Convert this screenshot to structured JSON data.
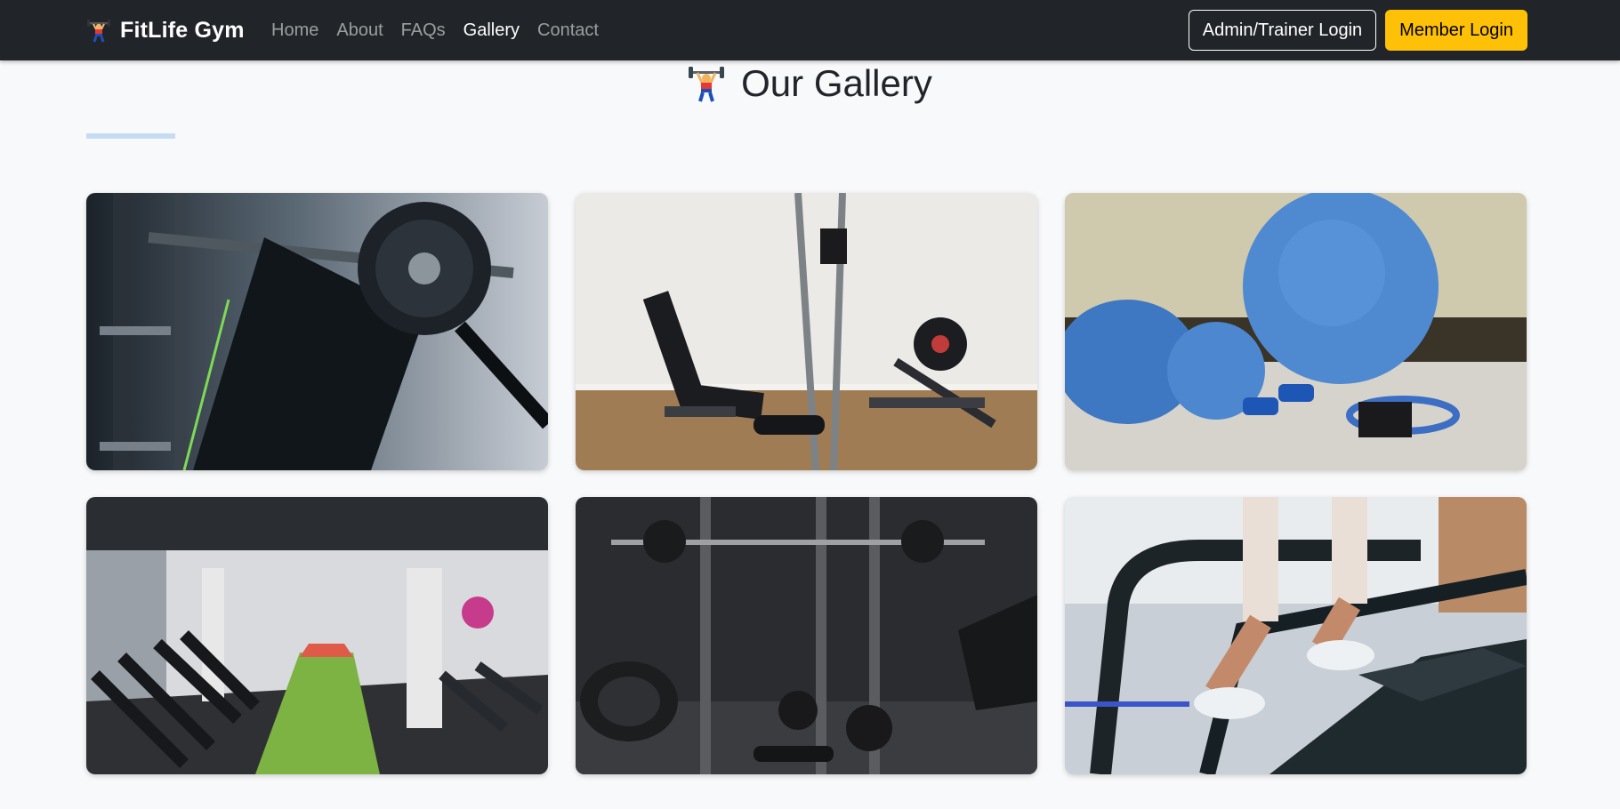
{
  "navbar": {
    "brand_icon": "weightlifter-icon",
    "brand": "FitLife Gym",
    "links": [
      {
        "label": "Home",
        "active": false
      },
      {
        "label": "About",
        "active": false
      },
      {
        "label": "FAQs",
        "active": false
      },
      {
        "label": "Gallery",
        "active": true
      },
      {
        "label": "Contact",
        "active": false
      }
    ],
    "admin_login": "Admin/Trainer Login",
    "member_login": "Member Login"
  },
  "gallery": {
    "title_icon": "weightlifter-icon",
    "title": "Our Gallery",
    "items": [
      "barbell-bench-photo",
      "home-gym-station-photo",
      "exercise-balls-photo",
      "gym-treadmill-floor-photo",
      "dark-weights-rack-photo",
      "stair-climber-photo"
    ]
  },
  "colors": {
    "navbar_bg": "#212529",
    "page_bg": "#f8f9fa",
    "accent_yellow": "#ffc107",
    "underline": "#c6dcf5"
  }
}
